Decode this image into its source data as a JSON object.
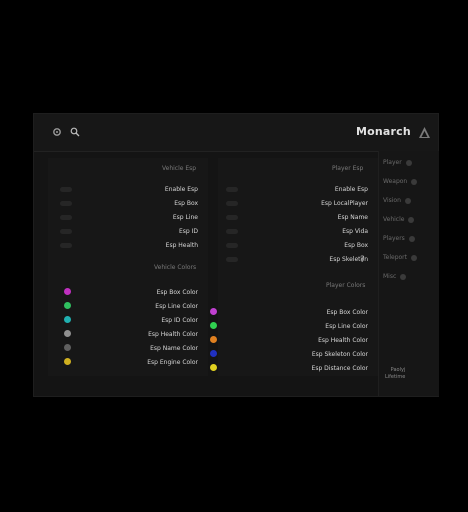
{
  "app": {
    "name": "Monarch"
  },
  "player_esp": {
    "title": "Player Esp",
    "options": [
      "Enable Esp",
      "Esp LocalPlayer",
      "Esp Name",
      "Esp Vida",
      "Esp Box",
      "Esp Skeleton"
    ]
  },
  "player_colors": {
    "title": "Player Colors",
    "options": [
      {
        "label": "Esp Box Color",
        "color": "#c040d0"
      },
      {
        "label": "Esp Line Color",
        "color": "#30d050"
      },
      {
        "label": "Esp Health Color",
        "color": "#e08020"
      },
      {
        "label": "Esp Skeleton Color",
        "color": "#2030c0"
      },
      {
        "label": "Esp Distance Color",
        "color": "#e0d020"
      }
    ]
  },
  "vehicle_esp": {
    "title": "Vehicle Esp",
    "options": [
      "Enable Esp",
      "Esp Box",
      "Esp Line",
      "Esp ID",
      "Esp Health"
    ]
  },
  "vehicle_colors": {
    "title": "Vehicle Colors",
    "options": [
      {
        "label": "Esp Box Color",
        "color": "#c030c0"
      },
      {
        "label": "Esp Line Color",
        "color": "#30c060"
      },
      {
        "label": "Esp ID Color",
        "color": "#20b0b0"
      },
      {
        "label": "Esp Health Color",
        "color": "#909090"
      },
      {
        "label": "Esp Name Color",
        "color": "#606060"
      },
      {
        "label": "Esp Engine Color",
        "color": "#d0b020"
      }
    ]
  },
  "sidebar": {
    "items": [
      "Player",
      "Weapon",
      "Vision",
      "Vehicle",
      "Players",
      "Teleport",
      "Misc"
    ]
  },
  "profile": {
    "line1": "Paolyj",
    "line2": "Lifetime"
  },
  "icons": {
    "gear": "gear-icon",
    "search": "search-icon",
    "brand": "monarch-logo-icon"
  }
}
